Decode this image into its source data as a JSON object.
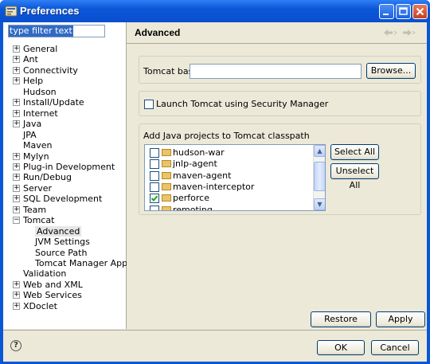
{
  "window": {
    "title": "Preferences"
  },
  "filter": {
    "value": "type filter text"
  },
  "tree": {
    "items": [
      {
        "label": "General",
        "expandable": true
      },
      {
        "label": "Ant",
        "expandable": true
      },
      {
        "label": "Connectivity",
        "expandable": true
      },
      {
        "label": "Help",
        "expandable": true
      },
      {
        "label": "Hudson",
        "expandable": false
      },
      {
        "label": "Install/Update",
        "expandable": true
      },
      {
        "label": "Internet",
        "expandable": true
      },
      {
        "label": "Java",
        "expandable": true
      },
      {
        "label": "JPA",
        "expandable": false
      },
      {
        "label": "Maven",
        "expandable": false
      },
      {
        "label": "Mylyn",
        "expandable": true
      },
      {
        "label": "Plug-in Development",
        "expandable": true
      },
      {
        "label": "Run/Debug",
        "expandable": true
      },
      {
        "label": "Server",
        "expandable": true
      },
      {
        "label": "SQL Development",
        "expandable": true
      },
      {
        "label": "Team",
        "expandable": true
      },
      {
        "label": "Tomcat",
        "expandable": true,
        "expanded": true
      },
      {
        "label": "Advanced",
        "child": true,
        "selected": true
      },
      {
        "label": "JVM Settings",
        "child": true
      },
      {
        "label": "Source Path",
        "child": true
      },
      {
        "label": "Tomcat Manager App",
        "child": true
      },
      {
        "label": "Validation",
        "expandable": false
      },
      {
        "label": "Web and XML",
        "expandable": true
      },
      {
        "label": "Web Services",
        "expandable": true
      },
      {
        "label": "XDoclet",
        "expandable": true
      }
    ]
  },
  "page": {
    "title": "Advanced",
    "tomcat_base_label": "Tomcat base",
    "tomcat_base_value": "",
    "browse_label": "Browse...",
    "security_label": "Launch Tomcat using Security Manager",
    "security_checked": false,
    "classpath_label": "Add Java projects to Tomcat classpath",
    "projects": [
      {
        "label": "hudson-war",
        "checked": false
      },
      {
        "label": "jnlp-agent",
        "checked": false
      },
      {
        "label": "maven-agent",
        "checked": false
      },
      {
        "label": "maven-interceptor",
        "checked": false
      },
      {
        "label": "perforce",
        "checked": true
      },
      {
        "label": "remoting",
        "checked": false
      }
    ],
    "select_all_label": "Select All",
    "unselect_all_label": "Unselect All",
    "restore_defaults_label": "Restore Defaults",
    "apply_label": "Apply"
  },
  "footer": {
    "ok_label": "OK",
    "cancel_label": "Cancel"
  },
  "icons": {
    "help": "help-icon",
    "back": "back-arrow-icon",
    "forward": "forward-arrow-icon"
  }
}
